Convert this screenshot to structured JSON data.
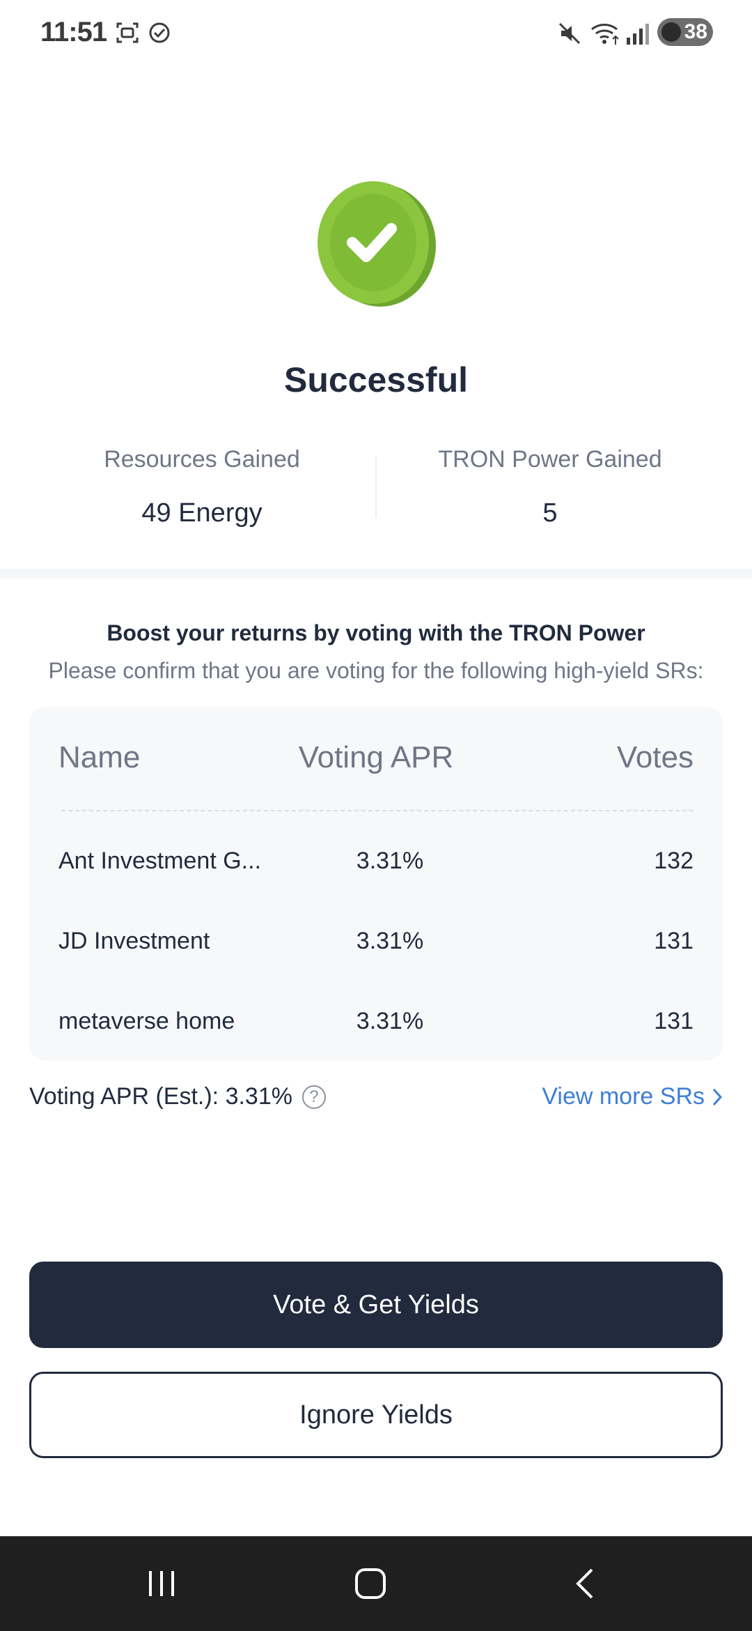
{
  "status_bar": {
    "time": "11:51",
    "battery": "38",
    "icons": [
      "screenshot-icon",
      "check-circle-icon",
      "mute-icon",
      "wifi-icon",
      "signal-icon",
      "battery-icon"
    ]
  },
  "success": {
    "title": "Successful",
    "resources_label": "Resources Gained",
    "resources_value": "49 Energy",
    "power_label": "TRON Power Gained",
    "power_value": "5"
  },
  "boost": {
    "title": "Boost your returns by voting with the TRON Power",
    "subtitle": "Please confirm that you are voting for the following high-yield SRs:"
  },
  "table": {
    "headers": {
      "name": "Name",
      "apr": "Voting APR",
      "votes": "Votes"
    },
    "rows": [
      {
        "name": "Ant Investment G...",
        "apr": "3.31%",
        "votes": "132"
      },
      {
        "name": "JD Investment",
        "apr": "3.31%",
        "votes": "131"
      },
      {
        "name": "metaverse home",
        "apr": "3.31%",
        "votes": "131"
      }
    ]
  },
  "footer": {
    "apr_est": "Voting APR (Est.): 3.31%",
    "help_glyph": "?",
    "view_more": "View more SRs"
  },
  "buttons": {
    "vote": "Vote & Get Yields",
    "ignore": "Ignore Yields"
  },
  "colors": {
    "primary": "#222a3d",
    "link": "#3d7ed6",
    "success_green": "#8cc63f",
    "muted": "#6f7686"
  }
}
